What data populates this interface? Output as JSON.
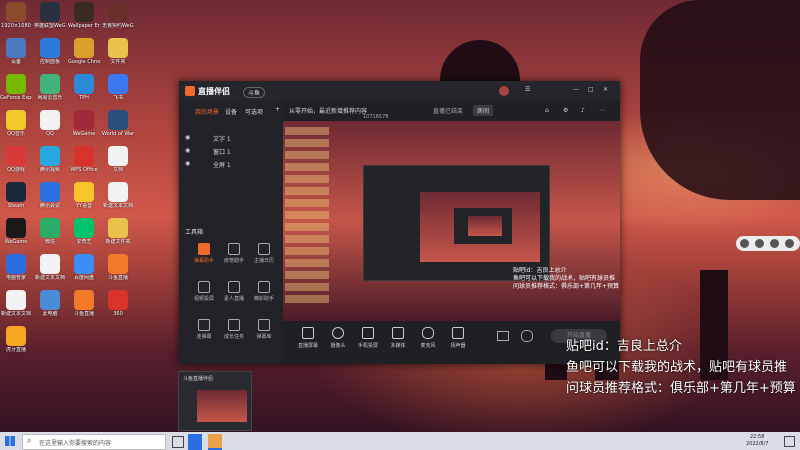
{
  "desktop": {
    "icons": [
      {
        "label": "1920×1080",
        "color": "#8a4a2a"
      },
      {
        "label": "英雄联盟WeGame版",
        "color": "#2b3040"
      },
      {
        "label": "Wallpaper Engine",
        "color": "#3a2a22"
      },
      {
        "label": "无畏契约WeGame版",
        "color": "#6a2f2b"
      },
      {
        "label": "设备",
        "color": "#4a79c4"
      },
      {
        "label": "控制面板",
        "color": "#2c7bd8"
      },
      {
        "label": "Google Chrome",
        "color": "#d9a12b"
      },
      {
        "label": "文件夹",
        "color": "#e8c24a"
      },
      {
        "label": "GeForce Experience",
        "color": "#76b900"
      },
      {
        "label": "网易云音乐",
        "color": "#3fb37a"
      },
      {
        "label": "TPH",
        "color": "#2a8ad8"
      },
      {
        "label": "飞书",
        "color": "#3a78f0"
      },
      {
        "label": "QQ音乐",
        "color": "#f0c82a"
      },
      {
        "label": "QQ",
        "color": "#f2f2f2"
      },
      {
        "label": "WeGame",
        "color": "#a12a3a"
      },
      {
        "label": "World of Warships",
        "color": "#2a4f7a"
      },
      {
        "label": "QQ游戏",
        "color": "#d83a3a"
      },
      {
        "label": "腾讯视频",
        "color": "#27a8e0"
      },
      {
        "label": "WPS Office",
        "color": "#d9322a"
      },
      {
        "label": "文档",
        "color": "#f2f2f2"
      },
      {
        "label": "Steam",
        "color": "#1b2838"
      },
      {
        "label": "腾讯会议",
        "color": "#2c6fe0"
      },
      {
        "label": "YY语音",
        "color": "#f7c52a"
      },
      {
        "label": "新建文本文档",
        "color": "#f2f2f2"
      },
      {
        "label": "WeGame",
        "color": "#1a1a1a"
      },
      {
        "label": "微信",
        "color": "#2aae67"
      },
      {
        "label": "爱奇艺",
        "color": "#00c36a"
      },
      {
        "label": "新建文件夹",
        "color": "#e8c24a"
      },
      {
        "label": "电脑管家",
        "color": "#2a6ee0"
      },
      {
        "label": "新建文本文档",
        "color": "#f2f2f2"
      },
      {
        "label": "百度网盘",
        "color": "#3c8ef5"
      },
      {
        "label": "斗鱼直播",
        "color": "#f37a2a"
      },
      {
        "label": "新建文本文档",
        "color": "#f2f2f2"
      },
      {
        "label": "此电脑",
        "color": "#4a8cd8"
      },
      {
        "label": "斗鱼直播",
        "color": "#f37a2a"
      },
      {
        "label": "360",
        "color": "#d8342a"
      },
      {
        "label": "虎牙直播",
        "color": "#f6a623"
      }
    ]
  },
  "app": {
    "title": "直播伴侣",
    "badge": "斗鱼",
    "tabs": [
      "我的场景",
      "设备",
      "可选项"
    ],
    "scene_items": [
      {
        "label": "文字 1"
      },
      {
        "label": "窗口 1"
      },
      {
        "label": "全屏 1"
      }
    ],
    "header_text": "从零开始，最近新增推荐内容",
    "live_text": "直播已结束",
    "room_button": "房间",
    "room_id": "10716578",
    "toolbox_title": "工具箱",
    "tools": [
      {
        "label": "弹幕助手",
        "active": true
      },
      {
        "label": "房管助手"
      },
      {
        "label": "主播日历"
      },
      {
        "label": "视频投屏"
      },
      {
        "label": "素人直播"
      },
      {
        "label": "精彩助手"
      },
      {
        "label": "连弹幕"
      },
      {
        "label": "成长任务"
      },
      {
        "label": "弹幕库"
      }
    ],
    "bottom_buttons": [
      {
        "label": "直播屏幕"
      },
      {
        "label": "摄像头"
      },
      {
        "label": "手机投屏"
      },
      {
        "label": "多媒体"
      },
      {
        "label": "麦克风"
      },
      {
        "label": "扬声器"
      }
    ],
    "start_button": "开始直播",
    "footer_note": "斗鱼直播伴侣"
  },
  "overlay": {
    "line1": "贴吧id：吉良上总介",
    "line2": "鱼吧可以下载我的战术，贴吧有球员推",
    "line3": "问球员推荐格式：俱乐部+第几年+预算"
  },
  "taskbar": {
    "search_placeholder": "在这里输入你要搜索的内容",
    "time": "22:58",
    "date": "2022/8/7"
  },
  "colors": {
    "accent": "#f06a2a",
    "window_bg": "#1f2024",
    "taskbar": "#d9dde6"
  }
}
